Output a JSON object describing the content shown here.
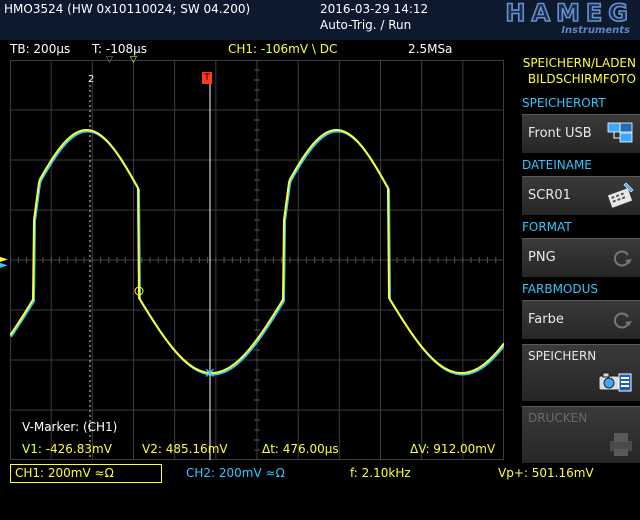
{
  "header": {
    "device": "HMO3524 (HW 0x10110024; SW 04.200)",
    "datetime": "2016-03-29 14:12",
    "trigger_state": "Auto-Trig. / Run",
    "logo_text": "HAMEG",
    "logo_sub": "Instruments"
  },
  "status": {
    "timebase": "TB: 200µs",
    "trigger_time": "T: -108µs",
    "ch1_trigger": "CH1: -106mV \\ DC",
    "sample_rate": "2.5MSa"
  },
  "markers": {
    "title": "V-Marker: (CH1)",
    "v1": "V1: -426.83mV",
    "v2": "V2: 485.16mV",
    "dt": "Δt: 476.00µs",
    "dv": "ΔV: 912.00mV",
    "cursor2_label": "2"
  },
  "bottom": {
    "ch1": "CH1: 200mV ≈Ω",
    "ch2": "CH2: 200mV ≈Ω",
    "freq": "f: 2.10kHz",
    "vp": "Vp+: 501.16mV"
  },
  "menu": {
    "title_line1": "SPEICHERN/LADEN",
    "title_line2": "BILDSCHIRMFOTO",
    "storage_label": "SPEICHERORT",
    "storage_value": "Front USB",
    "filename_label": "DATEINAME",
    "filename_value": "SCR01",
    "format_label": "FORMAT",
    "format_value": "PNG",
    "color_label": "FARBMODUS",
    "color_value": "Farbe",
    "save_label": "SPEICHERN",
    "print_label": "DRUCKEN"
  },
  "colors": {
    "ch1": "#ffff30",
    "ch2": "#2ec8ff",
    "grid": "#3c3c3c",
    "marker": "#ffffff",
    "accent_blue": "#2ec8ff"
  },
  "icons": {
    "storage": "usb-folder-icon",
    "filename": "keyboard-pen-icon",
    "format_cycle": "cycle-arrow-icon",
    "color_cycle": "cycle-arrow-icon",
    "save": "camera-save-icon",
    "print": "printer-icon"
  }
}
